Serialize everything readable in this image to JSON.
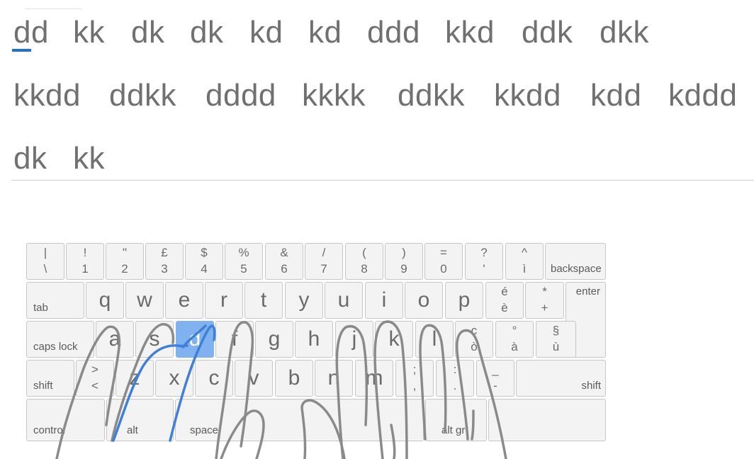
{
  "lesson": {
    "lines": [
      [
        "dd",
        "kk",
        "dk",
        "dk",
        "kd",
        "kd",
        "ddd",
        "kkd",
        "ddk",
        "dkk"
      ],
      [
        "kkdd",
        "ddkk",
        "dddd",
        "kkkk",
        "ddkk",
        "kkdd",
        "kdd",
        "kddd"
      ],
      [
        "dk",
        "kk"
      ]
    ],
    "current_word_index": 0
  },
  "keyboard": {
    "row1": [
      {
        "top": "|",
        "bottom": "\\"
      },
      {
        "top": "!",
        "bottom": "1"
      },
      {
        "top": "\"",
        "bottom": "2"
      },
      {
        "top": "£",
        "bottom": "3"
      },
      {
        "top": "$",
        "bottom": "4"
      },
      {
        "top": "%",
        "bottom": "5"
      },
      {
        "top": "&",
        "bottom": "6"
      },
      {
        "top": "/",
        "bottom": "7"
      },
      {
        "top": "(",
        "bottom": "8"
      },
      {
        "top": ")",
        "bottom": "9"
      },
      {
        "top": "=",
        "bottom": "0"
      },
      {
        "top": "?",
        "bottom": "'"
      },
      {
        "top": "^",
        "bottom": "ì"
      }
    ],
    "backspace_label": "backspace",
    "tab_label": "tab",
    "row2": [
      "q",
      "w",
      "e",
      "r",
      "t",
      "y",
      "u",
      "i",
      "o",
      "p"
    ],
    "row2_extra": [
      {
        "top": "é",
        "bottom": "è"
      },
      {
        "top": "*",
        "bottom": "+"
      }
    ],
    "enter_label": "enter",
    "caps_lock_label": "caps lock",
    "row3": [
      "a",
      "s",
      "d",
      "f",
      "g",
      "h",
      "j",
      "k",
      "l"
    ],
    "row3_extra": [
      {
        "top": "ç",
        "bottom": "ò"
      },
      {
        "top": "°",
        "bottom": "à"
      },
      {
        "top": "§",
        "bottom": "ù"
      }
    ],
    "shift_left_label": "shift",
    "row4_first": {
      "top": ">",
      "bottom": "<"
    },
    "row4": [
      "z",
      "x",
      "c",
      "v",
      "b",
      "n",
      "m"
    ],
    "row4_extra": [
      {
        "top": ";",
        "bottom": ","
      },
      {
        "top": ":",
        "bottom": "."
      },
      {
        "top": "_",
        "bottom": "-"
      }
    ],
    "shift_right_label": "shift",
    "control_label": "control",
    "alt_label": "alt",
    "space_label": "space",
    "alt_gr_label": "alt gr",
    "highlighted_key": "d"
  },
  "colors": {
    "highlight_key": "#7fb2ef",
    "finger_guide": "#3f7fd6",
    "hand_outline": "#8a8a8a",
    "cursor": "#1e6fd8"
  },
  "icons": {
    "hands": "typing-hands-illustration"
  }
}
